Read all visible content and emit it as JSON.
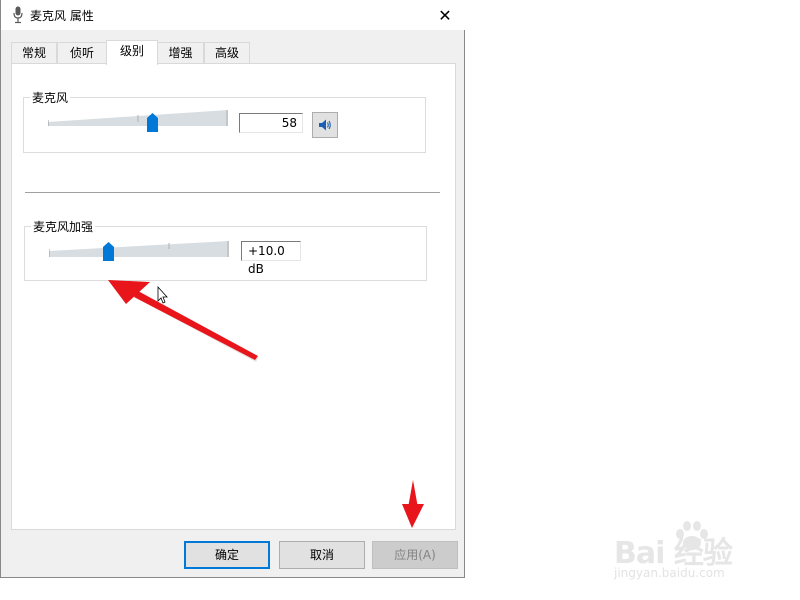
{
  "window": {
    "title": "麦克风 属性",
    "icon": "microphone-icon",
    "close": "✕"
  },
  "tabs": [
    {
      "label": "常规",
      "active": false
    },
    {
      "label": "侦听",
      "active": false
    },
    {
      "label": "级别",
      "active": true
    },
    {
      "label": "增强",
      "active": false
    },
    {
      "label": "高级",
      "active": false
    }
  ],
  "microphone": {
    "label": "麦克风",
    "value": "58",
    "level": 58,
    "speaker_icon": "speaker-icon"
  },
  "boost": {
    "label": "麦克风加强",
    "value": "+10.0 dB",
    "level_fraction": 0.3333
  },
  "buttons": {
    "ok": "确定",
    "cancel": "取消",
    "apply": "应用(A)"
  },
  "watermark": {
    "main": "Bai 经验",
    "sub": "jingyan.baidu.com"
  },
  "colors": {
    "accent": "#0078d7",
    "annotation_arrow": "#e8151a"
  }
}
